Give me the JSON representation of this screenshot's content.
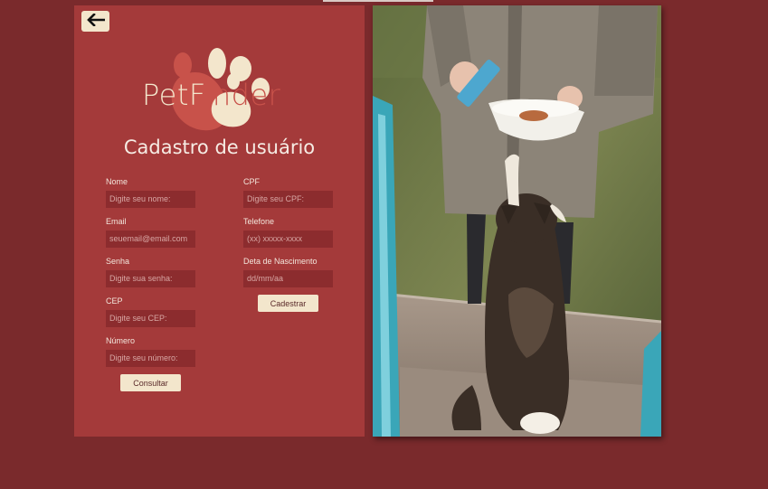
{
  "header": {
    "back_icon": "arrow-left-icon"
  },
  "logo": {
    "text_start": "PetF",
    "text_accent": "inder",
    "icon": "paw-icon"
  },
  "page_title": "Cadastro de usuário",
  "form": {
    "left_fields": [
      {
        "label": "Nome",
        "placeholder": "Digite seu nome:"
      },
      {
        "label": "Email",
        "placeholder": "seuemail@email.com"
      },
      {
        "label": "Senha",
        "placeholder": "Digite sua senha:"
      },
      {
        "label": "CEP",
        "placeholder": "Digite seu CEP:"
      },
      {
        "label": "Número",
        "placeholder": "Digite seu número:"
      }
    ],
    "right_fields": [
      {
        "label": "CPF",
        "placeholder": "Digite seu CPF:"
      },
      {
        "label": "Telefone",
        "placeholder": "(xx) xxxxx-xxxx"
      },
      {
        "label": "Deta de Nascimento",
        "placeholder": "dd/mm/aa"
      }
    ],
    "consult_button": "Consultar",
    "register_button": "Cadestrar"
  },
  "colors": {
    "background": "#7a2a2c",
    "panel": "#a43a3a",
    "input": "#8c2c2e",
    "button": "#f3e6cc",
    "logo_accent": "#c8524a"
  },
  "photo": {
    "subject": "cat-reaching-for-food-bowl"
  }
}
